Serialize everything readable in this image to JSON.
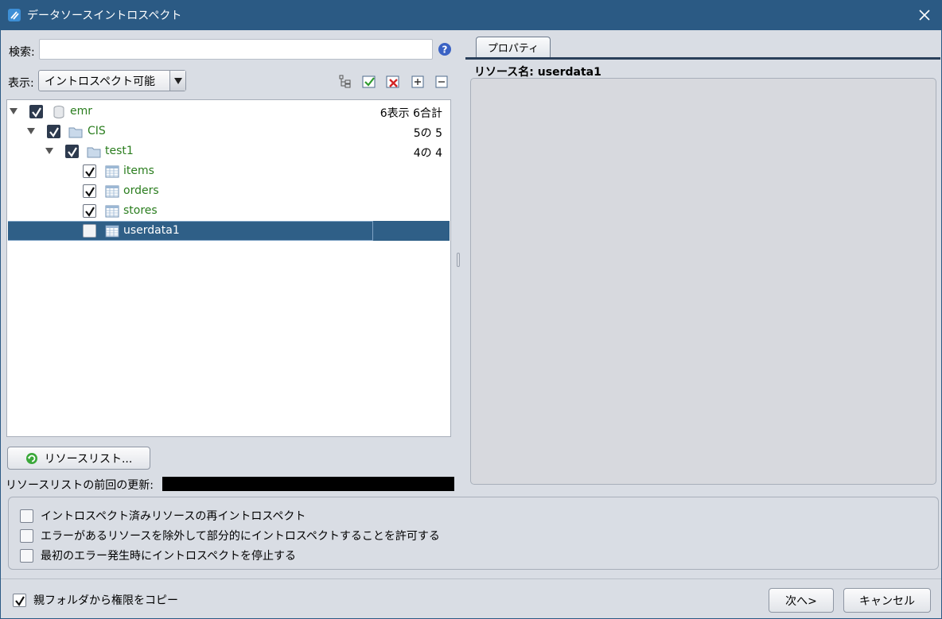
{
  "window": {
    "title": "データソースイントロスペクト"
  },
  "left": {
    "search_label": "検索:",
    "search_value": "",
    "display_label": "表示:",
    "display_select": "イントロスペクト可能",
    "tree": [
      {
        "name": "emr",
        "count": "6表示 6合計",
        "checked": true,
        "icon": "database-icon",
        "expanded": true
      },
      {
        "name": "CIS",
        "count": "5の 5",
        "checked": true,
        "icon": "folder-icon",
        "expanded": true
      },
      {
        "name": "test1",
        "count": "4の 4",
        "checked": true,
        "icon": "folder-icon",
        "expanded": true
      },
      {
        "name": "items",
        "count": "",
        "checked": true,
        "icon": "table-icon"
      },
      {
        "name": "orders",
        "count": "",
        "checked": true,
        "icon": "table-icon"
      },
      {
        "name": "stores",
        "count": "",
        "checked": true,
        "icon": "table-icon"
      },
      {
        "name": "userdata1",
        "count": "",
        "checked": false,
        "icon": "table-icon",
        "selected": true
      }
    ],
    "resource_list_button": "リソースリスト...",
    "last_update_label": "リソースリストの前回の更新:"
  },
  "right": {
    "tab_label": "プロパティ",
    "resource_name": "リソース名: userdata1"
  },
  "options": [
    "イントロスペクト済みリソースの再イントロスペクト",
    "エラーがあるリソースを除外して部分的にイントロスペクトすることを許可する",
    "最初のエラー発生時にイントロスペクトを停止する"
  ],
  "footer": {
    "copy_permissions_label": "親フォルダから権限をコピー",
    "copy_permissions_checked": true,
    "next_button": "次へ>",
    "cancel_button": "キャンセル"
  },
  "colors": {
    "titlebar": "#2b5a84",
    "selection": "#2f5f87",
    "tree_text": "#2a7d1e"
  }
}
